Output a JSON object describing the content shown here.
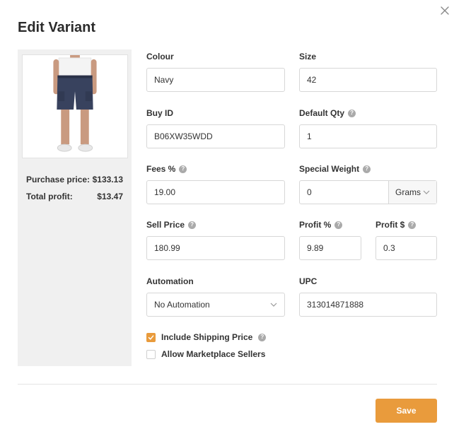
{
  "dialog": {
    "title": "Edit Variant"
  },
  "summary": {
    "purchase_label": "Purchase price:",
    "purchase_value": "$133.13",
    "profit_label": "Total profit:",
    "profit_value": "$13.47"
  },
  "fields": {
    "colour": {
      "label": "Colour",
      "value": "Navy"
    },
    "size": {
      "label": "Size",
      "value": "42"
    },
    "buy_id": {
      "label": "Buy ID",
      "value": "B06XW35WDD"
    },
    "default_qty": {
      "label": "Default Qty",
      "value": "1"
    },
    "fees": {
      "label": "Fees %",
      "value": "19.00"
    },
    "special_weight": {
      "label": "Special Weight",
      "value": "0",
      "unit": "Grams"
    },
    "sell_price": {
      "label": "Sell Price",
      "value": "180.99"
    },
    "profit_pct": {
      "label": "Profit %",
      "value": "9.89"
    },
    "profit_usd": {
      "label": "Profit $",
      "value": "0.3"
    },
    "automation": {
      "label": "Automation",
      "value": "No Automation"
    },
    "upc": {
      "label": "UPC",
      "value": "313014871888"
    }
  },
  "checkboxes": {
    "include_shipping": {
      "label": "Include Shipping Price",
      "checked": true
    },
    "allow_marketplace": {
      "label": "Allow Marketplace Sellers",
      "checked": false
    }
  },
  "actions": {
    "save_label": "Save"
  },
  "colors": {
    "accent": "#e99b3c",
    "panel": "#f0f0f0",
    "border": "#d7d7d7"
  },
  "icons": {
    "close": "close-icon",
    "help": "help-icon",
    "chevron": "chevron-down-icon",
    "check": "checkmark-icon",
    "product": "shorts-product-image"
  }
}
